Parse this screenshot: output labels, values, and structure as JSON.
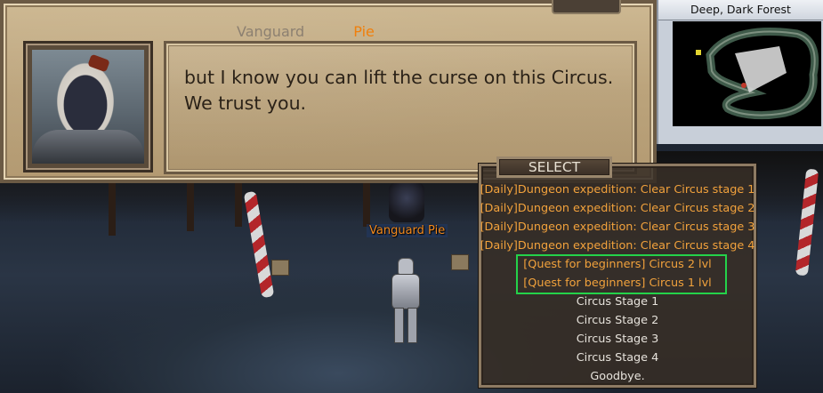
{
  "dialog": {
    "speaker_role": "Vanguard",
    "speaker_name": "Pie",
    "text_line1": "but I know you can lift the curse on this Circus.",
    "text_line2": "We trust you."
  },
  "minimap": {
    "title": "Deep, Dark Forest"
  },
  "world": {
    "npc_label": "Vanguard Pie"
  },
  "select": {
    "title": "SELECT",
    "options": [
      {
        "label": "[Daily]Dungeon expedition: Clear Circus stage 1",
        "color": "#f2a23c"
      },
      {
        "label": "[Daily]Dungeon expedition: Clear Circus stage 2",
        "color": "#f2a23c"
      },
      {
        "label": "[Daily]Dungeon expedition: Clear Circus stage 3",
        "color": "#f2a23c"
      },
      {
        "label": "[Daily]Dungeon expedition: Clear Circus stage 4",
        "color": "#f2a23c"
      },
      {
        "label": "[Quest for beginners] Circus 2 lvl",
        "color": "#f2a23c"
      },
      {
        "label": "[Quest for beginners] Circus 1 lvl",
        "color": "#f2a23c"
      },
      {
        "label": "Circus Stage 1",
        "color": "#e7e3dc"
      },
      {
        "label": "Circus Stage 2",
        "color": "#e7e3dc"
      },
      {
        "label": "Circus Stage 3",
        "color": "#e7e3dc"
      },
      {
        "label": "Circus Stage 4",
        "color": "#e7e3dc"
      },
      {
        "label": "Goodbye.",
        "color": "#e7e3dc"
      }
    ],
    "highlight_color": "#24d24a"
  }
}
